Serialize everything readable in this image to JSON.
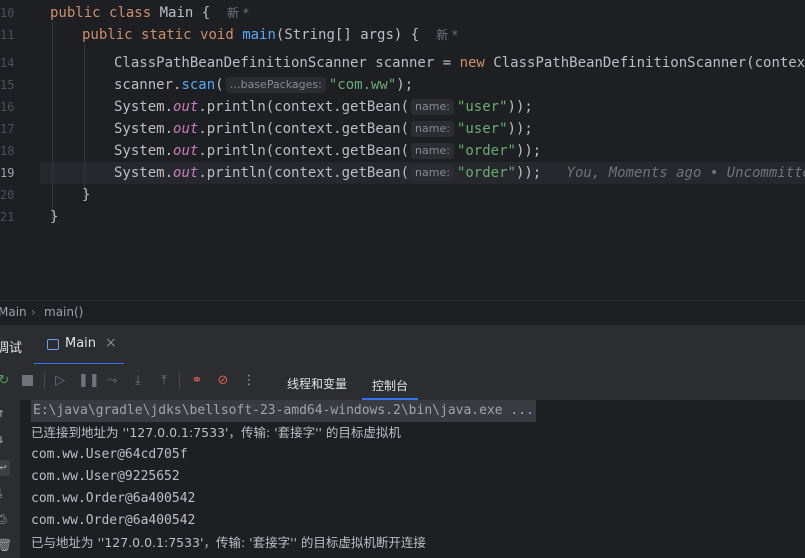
{
  "editor": {
    "line_numbers": [
      "10",
      "11",
      "14",
      "15",
      "16",
      "17",
      "18",
      "19",
      "20",
      "21"
    ],
    "line10": {
      "kw1": "public",
      "kw2": "class",
      "name": "Main",
      "brace": " {",
      "meta": "新 *"
    },
    "line11": {
      "kw1": "public",
      "kw2": "static",
      "kw3": "void",
      "fn": "main",
      "params": "(String[] args) {",
      "meta": "新 *"
    },
    "line14": {
      "type": "ClassPathBeanDefinitionScanner scanner = ",
      "kw": "new",
      "rest": " ClassPathBeanDefinitionScanner(context);"
    },
    "line15": {
      "pre": "scanner.",
      "fn": "scan",
      "open": "(",
      "hint": "…basePackages:",
      "str": "\"com.ww\"",
      "close": ");"
    },
    "line16": {
      "pre": "System.",
      "st": "out",
      "mid": ".println(context.getBean(",
      "hint": "name:",
      "str": "\"user\"",
      "close": "));"
    },
    "line17": {
      "pre": "System.",
      "st": "out",
      "mid": ".println(context.getBean(",
      "hint": "name:",
      "str": "\"user\"",
      "close": "));"
    },
    "line18": {
      "pre": "System.",
      "st": "out",
      "mid": ".println(context.getBean(",
      "hint": "name:",
      "str": "\"order\"",
      "close": "));"
    },
    "line19": {
      "pre": "System.",
      "st": "out",
      "mid": ".println(context.getBean(",
      "hint": "name:",
      "str": "\"order\"",
      "close": "));",
      "blame": "You, Moments ago • Uncommitted ch"
    },
    "line20": {
      "text": "}"
    },
    "line21": {
      "text": "}"
    }
  },
  "breadcrumbs": {
    "item1": "Main",
    "sep": "›",
    "item2": "main()"
  },
  "panel": {
    "tool_label": "调试",
    "tab": "Main",
    "tab_close": "×",
    "sub_tabs": [
      "线程和变量",
      "控制台"
    ],
    "active_sub_tab": "控制台"
  },
  "console": {
    "lines": [
      "E:\\java\\gradle\\jdks\\bellsoft-23-amd64-windows.2\\bin\\java.exe ...",
      "已连接到地址为 ''127.0.0.1:7533'，传输: '套接字'' 的目标虚拟机",
      "com.ww.User@64cd705f",
      "com.ww.User@9225652",
      "com.ww.Order@6a400542",
      "com.ww.Order@6a400542",
      "已与地址为 ''127.0.0.1:7533'，传输: '套接字'' 的目标虚拟机断开连接"
    ]
  },
  "colors": {
    "accent": "#3574f0",
    "keyword": "#cf8e6d",
    "string": "#6aab73",
    "function": "#56a8f5"
  },
  "icons": [
    "rerun-icon",
    "stop-icon",
    "resume-icon",
    "pause-icon",
    "step-over-icon",
    "step-into-icon",
    "step-out-icon",
    "view-breakpoints-icon",
    "mute-breakpoints-icon",
    "more-icon",
    "scroll-up-icon",
    "scroll-down-icon",
    "soft-wrap-icon",
    "scroll-end-icon",
    "print-icon",
    "trash-icon"
  ]
}
